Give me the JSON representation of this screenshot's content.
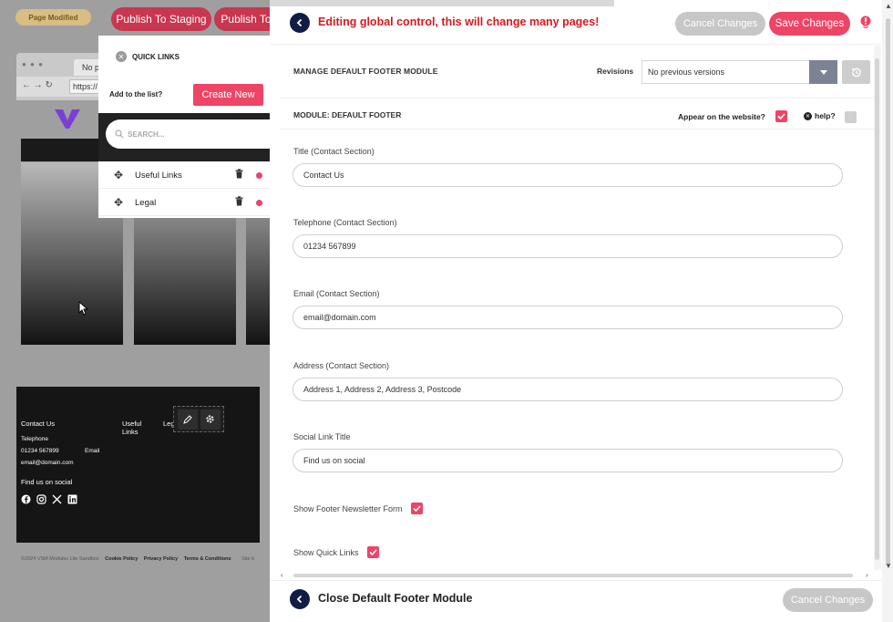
{
  "background": {
    "badge": "Page Modified",
    "publish_staging": "Publish To Staging",
    "publish_live": "Publish To",
    "browser_tab": "No page",
    "browser_url": "https://",
    "footer": {
      "contact_heading": "Contact Us",
      "useful_heading": "Useful Links",
      "legal_heading": "Lega",
      "telephone_label": "Telephone",
      "telephone_value": "01234 567899",
      "email_label": "Email",
      "email_value": "email@domain.com",
      "social_title": "Find us on social"
    },
    "copyright": "©2024 VSM Modules Lite Sandbox",
    "legal_links": [
      "Cookie Policy",
      "Privacy Policy",
      "Terms & Conditions"
    ],
    "site_by": "Site b"
  },
  "quick_links": {
    "title": "QUICK LINKS",
    "add_label": "Add to the list?",
    "create_button": "Create New",
    "search_placeholder": "SEARCH...",
    "items": [
      {
        "label": "Useful Links"
      },
      {
        "label": "Legal"
      }
    ]
  },
  "panel": {
    "warning": "Editing global control, this will change many pages!",
    "cancel_button": "Cancel Changes",
    "save_button": "Save Changes",
    "manage_title": "MANAGE DEFAULT FOOTER MODULE",
    "revisions_label": "Revisions",
    "revisions_value": "No previous versions",
    "module_title": "MODULE: DEFAULT FOOTER",
    "appear_label": "Appear on the website?",
    "help_label": "help?",
    "fields": [
      {
        "label": "Title (Contact Section)",
        "value": "Contact Us"
      },
      {
        "label": "Telephone (Contact Section)",
        "value": "01234 567899"
      },
      {
        "label": "Email (Contact Section)",
        "value": "email@domain.com"
      },
      {
        "label": "Address (Contact Section)",
        "value": "Address 1, Address 2, Address 3, Postcode"
      },
      {
        "label": "Social Link Title",
        "value": "Find us on social"
      }
    ],
    "toggles": [
      {
        "label": "Show Footer Newsletter Form",
        "checked": true
      },
      {
        "label": "Show Quick Links",
        "checked": true
      }
    ],
    "close_label": "Close Default Footer Module",
    "footer_cancel": "Cancel Changes"
  },
  "colors": {
    "accent": "#ee4466",
    "navy": "#111d44",
    "warning_red": "#d7191f",
    "disabled": "#c7c7c7"
  }
}
